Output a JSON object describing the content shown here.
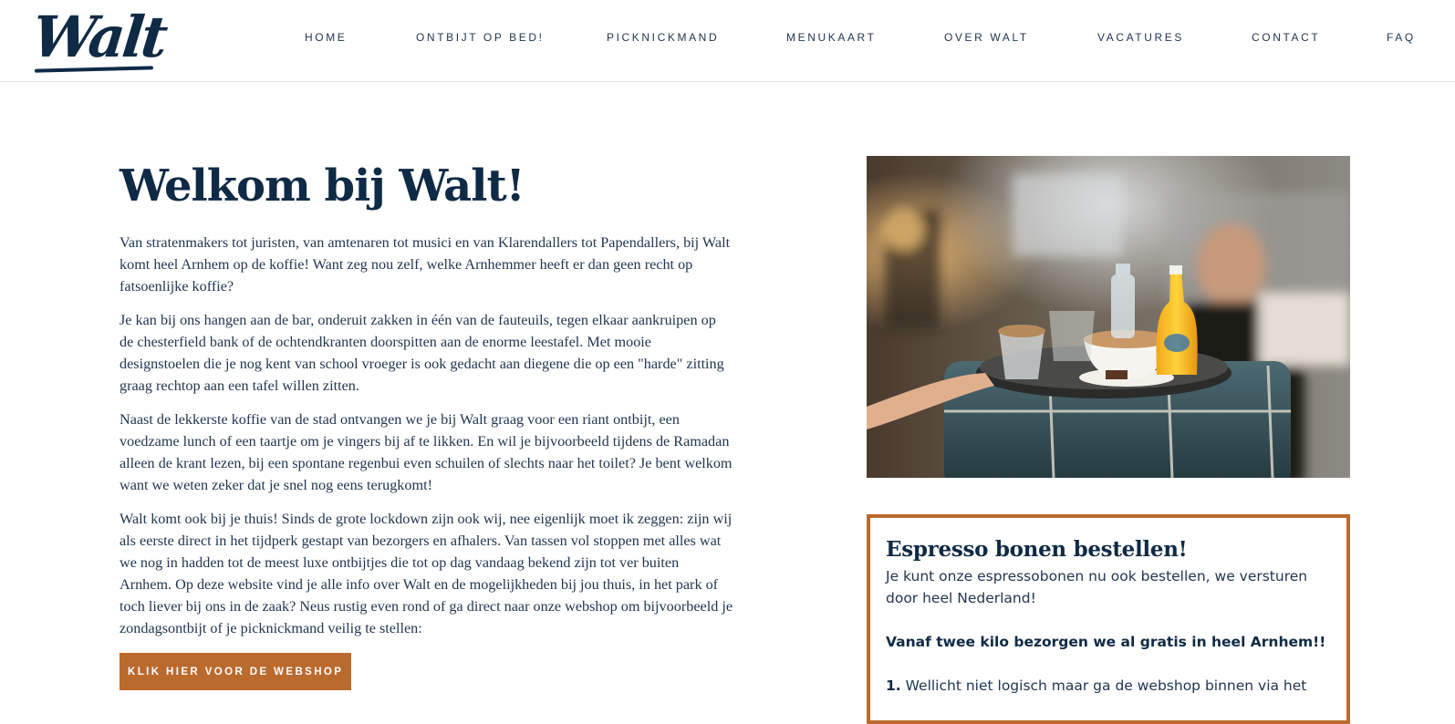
{
  "header": {
    "logo_text": "Walt",
    "nav": [
      {
        "label": "HOME",
        "name": "nav-item-home"
      },
      {
        "label": "ONTBIJT OP BED!",
        "name": "nav-item-ontbijt-op-bed"
      },
      {
        "label": "PICKNICKMAND",
        "name": "nav-item-picknickmand"
      },
      {
        "label": "MENUKAART",
        "name": "nav-item-menukaart"
      },
      {
        "label": "OVER WALT",
        "name": "nav-item-over-walt"
      },
      {
        "label": "VACATURES",
        "name": "nav-item-vacatures"
      },
      {
        "label": "CONTACT",
        "name": "nav-item-contact"
      },
      {
        "label": "FAQ",
        "name": "nav-item-faq"
      }
    ]
  },
  "main": {
    "title": "Welkom bij Walt!",
    "paragraphs": [
      "Van stratenmakers tot juristen, van amtenaren tot musici en van Klarendallers tot Papendallers, bij Walt komt heel Arnhem op de koffie! Want zeg nou zelf, welke Arnhemmer heeft er dan geen recht op fatsoenlijke koffie?",
      "Je kan bij ons hangen aan de bar, onderuit zakken in één van de fauteuils, tegen elkaar aankruipen op de chesterfield bank of de ochtendkranten doorspitten aan de enorme leestafel. Met mooie designstoelen die je nog kent van school vroeger is ook gedacht aan diegene die op een \"harde\" zitting graag rechtop aan een tafel willen zitten.",
      "Naast de lekkerste koffie van de stad ontvangen we je bij Walt graag voor een riant ontbijt, een voedzame lunch of een taartje om je vingers bij af te likken. En wil je bijvoorbeeld tijdens de Ramadan alleen de krant lezen, bij een spontane regenbui even schuilen of  slechts naar het toilet? Je bent welkom want we weten zeker dat je snel nog eens terugkomt!",
      "Walt komt ook bij je thuis! Sinds de grote lockdown zijn ook wij, nee eigenlijk moet ik zeggen: zijn wij als eerste direct in het tijdperk gestapt van bezorgers en afhalers. Van tassen vol stoppen met alles wat we nog in hadden tot de meest luxe ontbijtjes die tot op dag vandaag bekend zijn tot ver buiten Arnhem. Op deze website vind je alle info over Walt en de mogelijkheden bij jou thuis, in het park of toch liever bij ons in de zaak? Neus rustig even rond of ga direct naar onze webshop om bijvoorbeeld je zondagsontbijt of je picknickmand veilig te stellen:"
    ],
    "webshop_button": "KLIK HIER VOOR DE WEBSHOP"
  },
  "sidebar": {
    "espresso": {
      "title": "Espresso bonen bestellen!",
      "text": "Je kunt onze espressobonen nu ook bestellen, we versturen door heel Nederland!",
      "highlight": "Vanaf twee kilo bezorgen we al gratis in heel Arnhem!!",
      "step_number": "1.",
      "step_text": " Wellicht niet logisch maar ga de webshop binnen via het"
    }
  },
  "colors": {
    "navy": "#0f2a45",
    "accent_copper": "#bb6a2e"
  }
}
